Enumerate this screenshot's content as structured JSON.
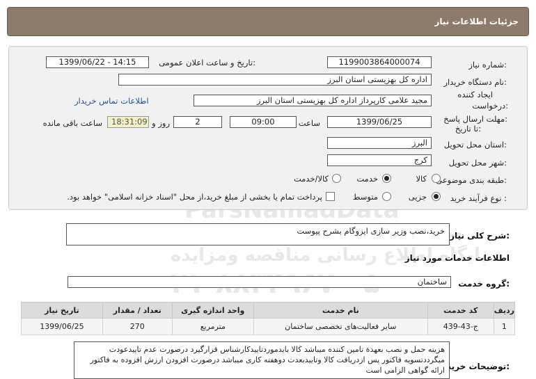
{
  "header": {
    "title": "جزئیات اطلاعات نیاز"
  },
  "fields": {
    "need_number_label": "شماره نیاز:",
    "need_number": "1199003864000074",
    "announce_label": "تاریخ و ساعت اعلان عمومی:",
    "announce_value": "1399/06/22 - 14:15",
    "buyer_org_label": "نام دستگاه خریدار:",
    "buyer_org": "اداره کل بهزیستی استان البرز",
    "requester_label_1": "ایجاد کننده",
    "requester_label_2": "درخواست:",
    "requester": "مجید علامی کارپرداز اداره کل بهزیستی استان البرز",
    "contact_link": "اطلاعات تماس خریدار",
    "deadline_label_1": "مهلت ارسال پاسخ:",
    "deadline_label_2": "تا تاریخ:",
    "deadline_date": "1399/06/25",
    "time_label": "ساعت",
    "deadline_time": "09:00",
    "days_value": "2",
    "days_label": "روز و",
    "remaining_time": "18:31:09",
    "remaining_label": "ساعت باقی مانده",
    "province_label": "استان محل تحویل:",
    "province": "البرز",
    "city_label": "شهر محل تحویل:",
    "city": "کرج",
    "category_label": "طبقه بندی موضوعی:",
    "category_options": [
      "کالا",
      "خدمت",
      "کالا/خدمت"
    ],
    "process_label": "نوع فرآیند خرید :",
    "process_options": [
      "جزیی",
      "متوسط"
    ],
    "payment_note": "پرداخت تمام یا بخشی از مبلغ خرید،از محل \"اسناد خزانه اسلامی\" خواهد بود."
  },
  "summary": {
    "label": "شرح کلی نیاز:",
    "text": "خرید،نصب وزیر سازی ایزوگام بشرح پیوست"
  },
  "services": {
    "section_title": "اطلاعات خدمات مورد نیاز",
    "group_label": "گروه خدمت:",
    "group_value": "ساختمان",
    "table": {
      "headers": [
        "ردیف",
        "کد خدمت",
        "نام خدمت",
        "واحد اندازه گیری",
        "تعداد / مقدار",
        "تاریخ نیاز"
      ],
      "rows": [
        [
          "1",
          "ج-43-439",
          "سایر فعالیت‌های تخصصی ساختمان",
          "مترمربع",
          "270",
          "1399/06/25"
        ]
      ]
    }
  },
  "notes": {
    "label": "توضیحات خریدار:",
    "text": "هزینه حمل و نصب بعهدة تامین کننده میباشد کالا بایدموردتاییدکارشناس قرارگیرد درصورت عدم تاییدعودت میگرددتسویه فاکتور پس ازدریافت کالا وتاییدبعدت دوهفته کاری میباشد درصورت افزودن ارزش افزوده به فاکتور ارائه گواهی الزامی است"
  },
  "watermark": {
    "name_en": "ParsNamadData",
    "line_fa_1": "مرکز فراوری اطلاعات پارس نماد داده",
    "line_fa_2": "پایگاه اطلاع رسانی مناقصه ومزایده",
    "phone": "۰۲۱-۸۸۳۴۹۶۷۰-۵"
  }
}
